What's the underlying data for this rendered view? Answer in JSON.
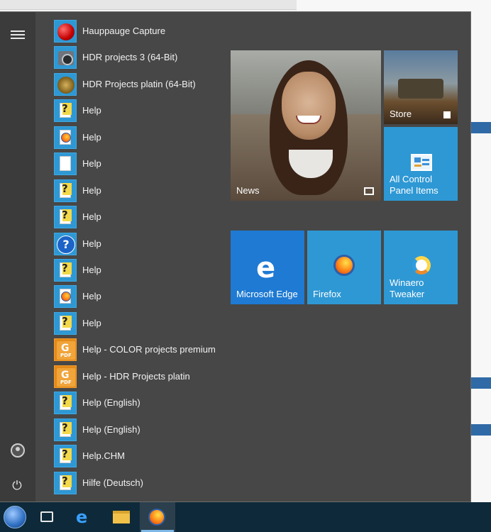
{
  "app_list": [
    {
      "label": "Hauppauge Capture",
      "icon": "red-ball-icon"
    },
    {
      "label": "HDR projects 3 (64-Bit)",
      "icon": "camera-lens-icon"
    },
    {
      "label": "HDR Projects platin (64-Bit)",
      "icon": "lens-icon"
    },
    {
      "label": "Help",
      "icon": "help-file-icon"
    },
    {
      "label": "Help",
      "icon": "firefox-doc-icon"
    },
    {
      "label": "Help",
      "icon": "blank-document-icon"
    },
    {
      "label": "Help",
      "icon": "help-file-icon"
    },
    {
      "label": "Help",
      "icon": "help-file-icon"
    },
    {
      "label": "Help",
      "icon": "question-circle-icon"
    },
    {
      "label": "Help",
      "icon": "help-file-icon"
    },
    {
      "label": "Help",
      "icon": "firefox-doc-icon"
    },
    {
      "label": "Help",
      "icon": "help-file-icon"
    },
    {
      "label": "Help - COLOR projects premium",
      "icon": "pdf-g-icon"
    },
    {
      "label": "Help - HDR Projects platin",
      "icon": "pdf-g-icon"
    },
    {
      "label": "Help (English)",
      "icon": "help-file-icon"
    },
    {
      "label": "Help (English)",
      "icon": "help-file-icon"
    },
    {
      "label": "Help.CHM",
      "icon": "help-file-icon"
    },
    {
      "label": "Hilfe (Deutsch)",
      "icon": "help-file-icon"
    }
  ],
  "tiles": {
    "news": "News",
    "store": "Store",
    "control_panel": "All Control Panel Items",
    "edge": "Microsoft Edge",
    "firefox": "Firefox",
    "winaero": "Winaero Tweaker"
  },
  "colors": {
    "tile_blue": "#2e98d4",
    "edge_blue": "#1e7ad3",
    "menu_bg": "#474747",
    "taskbar": "#0e2a3a"
  }
}
